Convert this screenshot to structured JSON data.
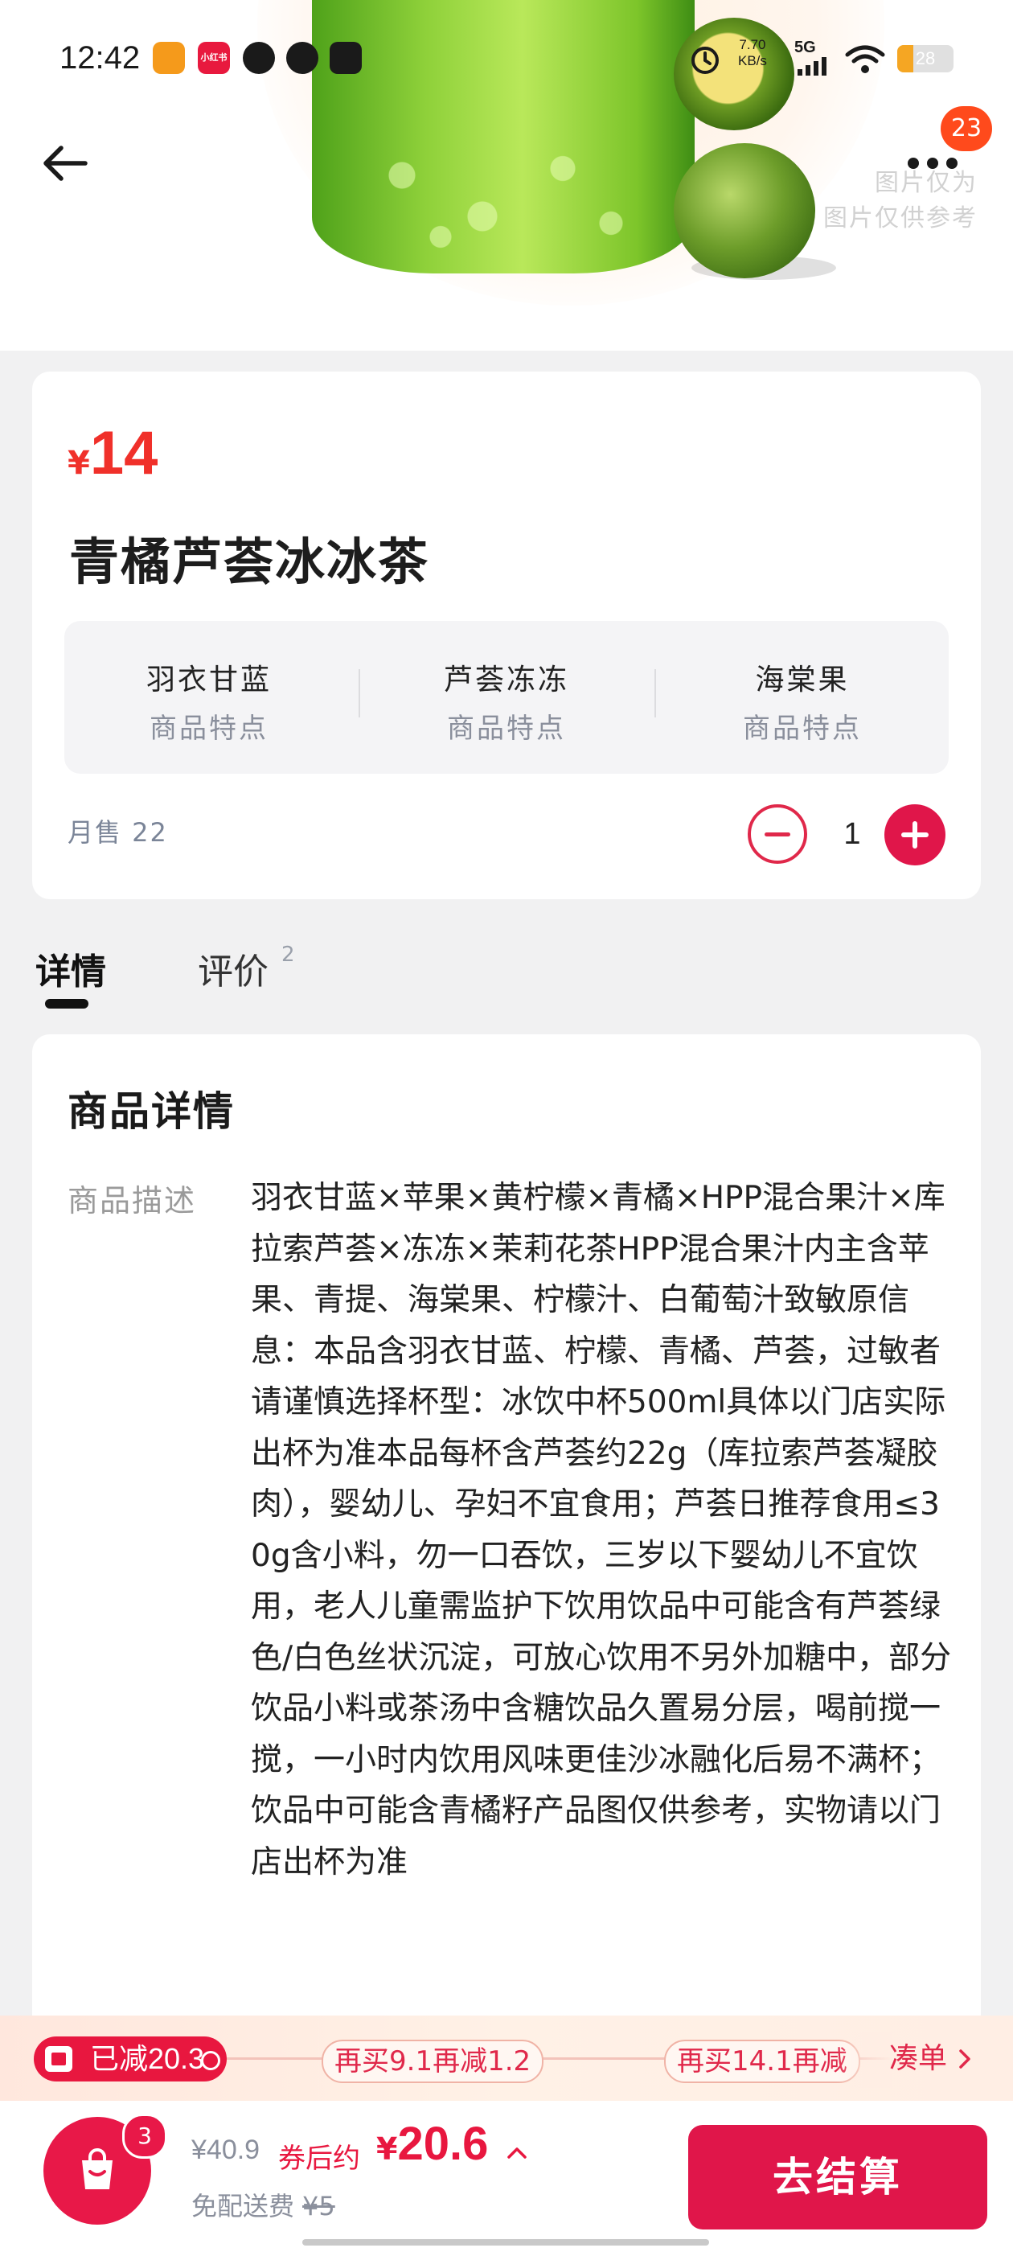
{
  "status_bar": {
    "time": "12:42",
    "net_speed": "7.70",
    "net_unit": "KB/s",
    "network": "5G",
    "battery": "28",
    "battery_level": 0.28,
    "app_icons": [
      {
        "name": "app-icon-orange",
        "color": "#f59a1b",
        "label": ""
      },
      {
        "name": "app-icon-redbook",
        "color": "#e8193e",
        "label": "小红书"
      },
      {
        "name": "app-icon-q",
        "color": "#1a1a1a",
        "label": ""
      },
      {
        "name": "app-icon-weibo",
        "color": "#1a1a1a",
        "label": ""
      },
      {
        "name": "app-icon-bag",
        "color": "#1a1a1a",
        "label": ""
      }
    ]
  },
  "header": {
    "back_icon": "arrow-left-icon",
    "more_icon": "more-dots-icon",
    "badge_count": "23"
  },
  "hero": {
    "watermark": [
      "图片仅为",
      "图片仅供参考"
    ]
  },
  "product": {
    "currency": "¥",
    "price": "14",
    "name": "青橘芦荟冰冰茶",
    "features": [
      {
        "name": "羽衣甘蓝",
        "sub": "商品特点"
      },
      {
        "name": "芦荟冻冻",
        "sub": "商品特点"
      },
      {
        "name": "海棠果",
        "sub": "商品特点"
      }
    ],
    "monthly_sales": "月售 22",
    "quantity": "1"
  },
  "tabs": [
    {
      "label": "详情",
      "active": true
    },
    {
      "label": "评价",
      "count": "2",
      "active": false
    }
  ],
  "detail": {
    "title": "商品详情",
    "desc_label": "商品描述",
    "description": "羽衣甘蓝×苹果×黄柠檬×青橘×HPP混合果汁×库拉索芦荟×冻冻×茉莉花茶HPP混合果汁内主含苹果、青提、海棠果、柠檬汁、白葡萄汁致敏原信息：本品含羽衣甘蓝、柠檬、青橘、芦荟，过敏者请谨慎选择杯型：冰饮中杯500ml具体以门店实际出杯为准本品每杯含芦荟约22g（库拉索芦荟凝胶肉），婴幼儿、孕妇不宜食用；芦荟日推荐食用≤30g含小料，勿一口吞饮，三岁以下婴幼儿不宜饮用，老人儿童需监护下饮用饮品中可能含有芦荟绿色/白色丝状沉淀，可放心饮用不另外加糖中，部分饮品小料或茶汤中含糖饮品久置易分层，喝前搅一搅，一小时内饮用风味更佳沙冰融化后易不满杯；饮品中可能含青橘籽产品图仅供参考，实物请以门店出杯为准"
  },
  "promo": {
    "applied": "已减20.3",
    "tiers": [
      "再买9.1再减1.2",
      "再买14.1再减"
    ],
    "more": "凑单",
    "more_icon": "chevron-right-icon"
  },
  "bottom": {
    "cart_icon": "shopping-bag-icon",
    "cart_count": "3",
    "original_price": "¥40.9",
    "after_label": "券后约",
    "currency": "¥",
    "after_price": "20.6",
    "expand_icon": "chevron-up-icon",
    "shipping_label": "免配送费",
    "shipping_orig": "¥5",
    "checkout": "去结算"
  },
  "colors": {
    "accent": "#e0164a",
    "price_red": "#f0302a",
    "badge_orange": "#ff4a1c"
  }
}
